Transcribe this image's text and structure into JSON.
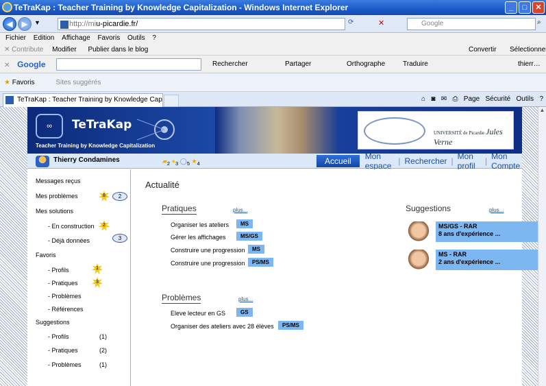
{
  "window": {
    "title": "TeTraKap : Teacher Training by Knowledge Capitalization - Windows Internet Explorer",
    "url_prefix": "http://mi",
    "url_domain": "u-picardie.fr/",
    "search_placeholder": "Google"
  },
  "menu": [
    "Fichier",
    "Edition",
    "Affichage",
    "Favoris",
    "Outils",
    "?"
  ],
  "toolbar1": {
    "contribute": "Contribute",
    "modifier": "Modifier",
    "publier": "Publier dans le blog",
    "convertir": "Convertir",
    "selectionner": "Sélectionner"
  },
  "googlebar": {
    "brand": "Google",
    "rechercher": "Rechercher",
    "partager": "Partager",
    "orthographe": "Orthographe",
    "traduire": "Traduire",
    "user": "thierr…"
  },
  "favbar": {
    "favoris": "Favoris",
    "suggested": "Sites suggérés"
  },
  "tab": {
    "title": "TeTraKap : Teacher Training by Knowledge Capitalizat…"
  },
  "commands": {
    "page": "Page",
    "securite": "Sécurité",
    "outils": "Outils"
  },
  "banner": {
    "title": "TeTraKap",
    "subtitle": "Teacher Training by Knowledge Capitalization",
    "univ": "UNIVERSITÉ de Picardie",
    "univ_name": "Jules Verne"
  },
  "user": {
    "name": "Thierry Condamines",
    "stat1": "2",
    "stat2": "3",
    "stat3": "5",
    "stat4": "4"
  },
  "nav": [
    "Accueil",
    "Mon espace",
    "Rechercher",
    "Mon profil",
    "Mon Compte"
  ],
  "sidebar": {
    "messages": "Messages reçus",
    "problemes": "Mes problèmes",
    "problemes_burst": "8",
    "problemes_bubble": "2",
    "solutions": "Mes solutions",
    "construction": "- En construction",
    "construction_burst": "2",
    "donnees": "- Déjà données",
    "donnees_bubble": "3",
    "favoris": "Favoris",
    "fav_profils": "- Profils",
    "fav_profils_burst": "1",
    "fav_pratiques": "- Pratiques",
    "fav_pratiques_burst": "3",
    "fav_problemes": "- Problèmes",
    "fav_references": "- Références",
    "suggestions": "Suggestions",
    "sug_profils": "- Profils",
    "sug_profils_count": "(1)",
    "sug_pratiques": "- Pratiques",
    "sug_pratiques_count": "(2)",
    "sug_problemes": "- Problèmes",
    "sug_problemes_count": "(1)"
  },
  "main": {
    "title": "Actualité",
    "pratiques_title": "Pratiques",
    "plus": "plus...",
    "pratiques": [
      {
        "label": "Organiser les ateliers",
        "tag": "MS"
      },
      {
        "label": "Gérer les affichages",
        "tag": "MS/GS"
      },
      {
        "label": "Construire une progression",
        "tag": "MS"
      },
      {
        "label": "Construire une progression",
        "tag": "PS/MS"
      }
    ],
    "problemes_title": "Problèmes",
    "problemes": [
      {
        "label": "Eleve lecteur en GS",
        "tag": "GS"
      },
      {
        "label": "Organiser des ateliers avec 28 élèves",
        "tag": "PS/MS"
      }
    ],
    "suggestions_title": "Suggestions",
    "suggestions": [
      {
        "line1": "MS/GS - RAR",
        "line2": "8 ans d'expérience ..."
      },
      {
        "line1": "MS - RAR",
        "line2": "2 ans d'expérience ..."
      }
    ]
  }
}
